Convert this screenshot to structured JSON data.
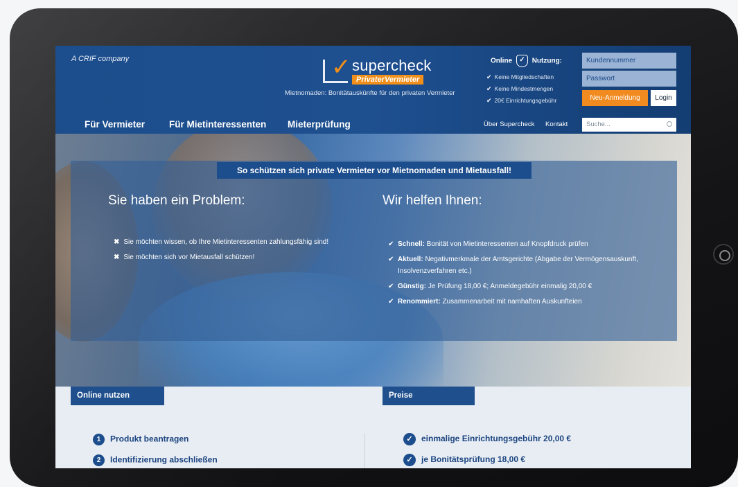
{
  "header": {
    "crif": "A CRIF company",
    "logo_name": "supercheck",
    "logo_sub": "PrivaterVermieter",
    "tagline": "Mietnomaden: Bonitätauskünfte für den privaten Vermieter",
    "usage_title_a": "Online",
    "usage_title_b": "Nutzung:",
    "usage": [
      "Keine Mitgliedschaften",
      "Keine Mindestmengen",
      "20€ Einrichtungsgebühr"
    ],
    "customer_placeholder": "Kundennummer",
    "password_placeholder": "Passwort",
    "register_label": "Neu-Anmeldung",
    "login_label": "Login"
  },
  "nav": {
    "items": [
      "Für Vermieter",
      "Für Mietinteressenten",
      "Mieterprüfung"
    ],
    "about": "Über Supercheck",
    "contact": "Kontakt",
    "search_placeholder": "Suche..."
  },
  "hero": {
    "banner": "So schützen sich private Vermieter vor Mietnomaden und Mietausfall!",
    "problem_heading": "Sie haben ein Problem:",
    "help_heading": "Wir helfen Ihnen:",
    "problems": [
      "Sie möchten wissen, ob Ihre Mietinteressenten zahlungsfähig sind!",
      "Sie möchten sich vor Mietausfall schützen!"
    ],
    "help": [
      {
        "bold": "Schnell:",
        "text": " Bonität von Mietinteressenten auf Knopfdruck prüfen"
      },
      {
        "bold": "Aktuell:",
        "text": " Negativmerkmale der Amtsgerichte (Abgabe der Vermögensauskunft, Insolvenzverfahren etc.)"
      },
      {
        "bold": "Günstig:",
        "text": " Je Prüfung 18,00 €; Anmeldegebühr einmalig 20,00 €"
      },
      {
        "bold": "Renommiert:",
        "text": " Zusammenarbeit mit namhaften Auskunfteien"
      }
    ]
  },
  "online": {
    "title": "Online nutzen",
    "steps": [
      {
        "num": "1",
        "label": "Produkt beantragen"
      },
      {
        "num": "2",
        "label": "Identifizierung abschließen"
      }
    ]
  },
  "prices": {
    "title": "Preise",
    "items": [
      "einmalige Einrichtungsgebühr 20,00 €",
      "je Bonitätsprüfung 18,00 €"
    ]
  }
}
